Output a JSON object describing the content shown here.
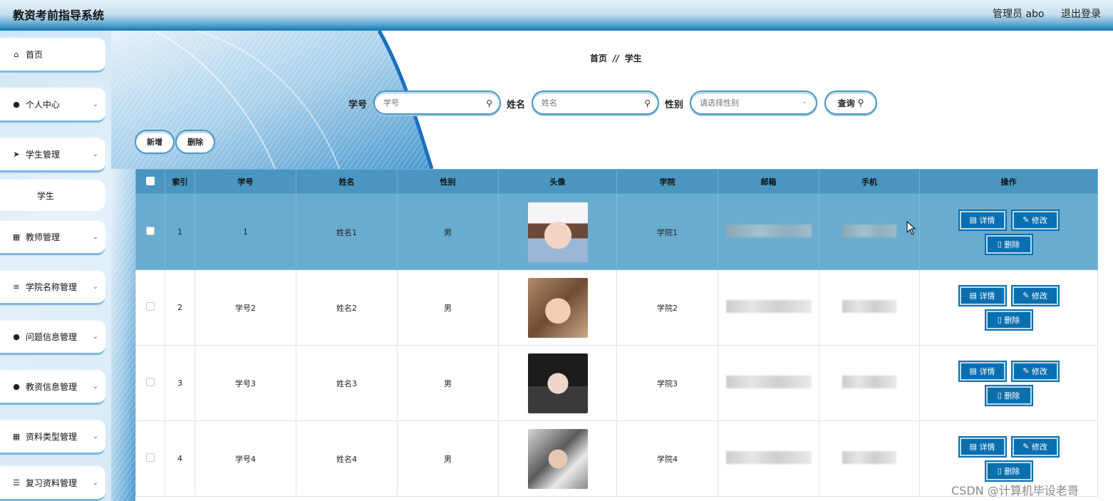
{
  "app": {
    "title": "教资考前指导系统",
    "admin": "管理员 abo",
    "logout": "退出登录"
  },
  "sidebar": {
    "items": [
      {
        "label": "首页",
        "icon": "home-icon"
      },
      {
        "label": "个人中心",
        "icon": "user-icon"
      },
      {
        "label": "学生管理",
        "icon": "send-icon"
      },
      {
        "label": "学生"
      },
      {
        "label": "教师管理",
        "icon": "grid-icon"
      },
      {
        "label": "学院名称管理",
        "icon": "sliders-icon"
      },
      {
        "label": "问题信息管理",
        "icon": "user-icon"
      },
      {
        "label": "教资信息管理",
        "icon": "user-icon"
      },
      {
        "label": "资料类型管理",
        "icon": "grid-icon"
      },
      {
        "label": "复习资料管理",
        "icon": "menu-icon"
      }
    ]
  },
  "breadcrumb": {
    "home": "首页",
    "sep": "//",
    "current": "学生"
  },
  "search": {
    "xuehao_label": "学号",
    "xuehao_placeholder": "学号",
    "xingming_label": "姓名",
    "xingming_placeholder": "姓名",
    "xingbie_label": "性别",
    "xingbie_placeholder": "请选择性别",
    "query_label": "查询"
  },
  "toolbar": {
    "add_label": "新增",
    "delete_label": "删除"
  },
  "table": {
    "headers": [
      "索引",
      "学号",
      "姓名",
      "性别",
      "头像",
      "学院",
      "邮箱",
      "手机",
      "操作"
    ],
    "rows": [
      {
        "index": "1",
        "xuehao": "1",
        "xingming": "姓名1",
        "xingbie": "男",
        "xueyuan": "学院1"
      },
      {
        "index": "2",
        "xuehao": "学号2",
        "xingming": "姓名2",
        "xingbie": "男",
        "xueyuan": "学院2"
      },
      {
        "index": "3",
        "xuehao": "学号3",
        "xingming": "姓名3",
        "xingbie": "男",
        "xueyuan": "学院3"
      },
      {
        "index": "4",
        "xuehao": "学号4",
        "xingming": "姓名4",
        "xingbie": "男",
        "xueyuan": "学院4"
      }
    ],
    "actions": {
      "detail": "详情",
      "edit": "修改",
      "delete": "删除"
    }
  },
  "watermark": "CSDN @计算机毕设老哥",
  "colors": {
    "accent": "#0a6fae",
    "header_bg": "#4a96c1",
    "selected_row": "#6aaccf"
  }
}
